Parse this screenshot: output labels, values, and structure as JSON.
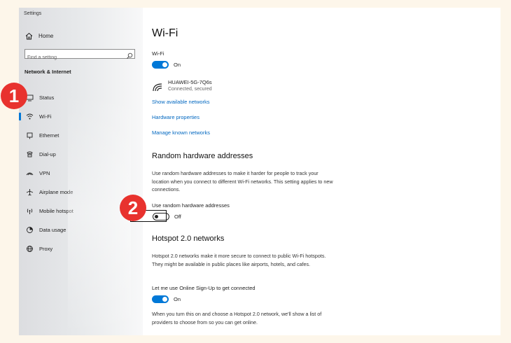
{
  "window": {
    "title": "Settings"
  },
  "sidebar": {
    "home_label": "Home",
    "search": {
      "placeholder": "Find a setting"
    },
    "section_title": "Network & Internet",
    "items": [
      {
        "label": "Status",
        "icon": "status-icon"
      },
      {
        "label": "Wi-Fi",
        "icon": "wifi-icon",
        "active": true
      },
      {
        "label": "Ethernet",
        "icon": "ethernet-icon"
      },
      {
        "label": "Dial-up",
        "icon": "dial-up-icon"
      },
      {
        "label": "VPN",
        "icon": "vpn-icon"
      },
      {
        "label": "Airplane mode",
        "icon": "airplane-icon"
      },
      {
        "label": "Mobile hotspot",
        "icon": "hotspot-icon"
      },
      {
        "label": "Data usage",
        "icon": "data-usage-icon"
      },
      {
        "label": "Proxy",
        "icon": "globe-icon"
      }
    ]
  },
  "main": {
    "title": "Wi-Fi",
    "wifi_toggle": {
      "label": "Wi-Fi",
      "state": "On"
    },
    "network": {
      "name": "HUAWEI-5G-7Q6s",
      "status": "Connected, secured"
    },
    "links": {
      "show_networks": "Show available networks",
      "hardware_properties": "Hardware properties",
      "manage_networks": "Manage known networks"
    },
    "random_hw": {
      "heading": "Random hardware addresses",
      "description": "Use random hardware addresses to make it harder for people to track your location when you connect to different Wi-Fi networks. This setting applies to new connections.",
      "toggle_label": "Use random hardware addresses",
      "state": "Off"
    },
    "hotspot": {
      "heading": "Hotspot 2.0 networks",
      "description": "Hotspot 2.0 networks make it more secure to connect to public Wi-Fi hotspots. They might be available in public places like airports, hotels, and cafes.",
      "toggle_label": "Let me use Online Sign-Up to get connected",
      "state": "On",
      "note": "When you turn this on and choose a Hotspot 2.0 network, we'll show a list of providers to choose from so you can get online."
    }
  },
  "annotations": {
    "step1": "1",
    "step2": "2"
  },
  "colors": {
    "accent": "#0078d7",
    "link": "#0067c0",
    "badge": "#e8322e",
    "background": "#fdf6ea"
  }
}
